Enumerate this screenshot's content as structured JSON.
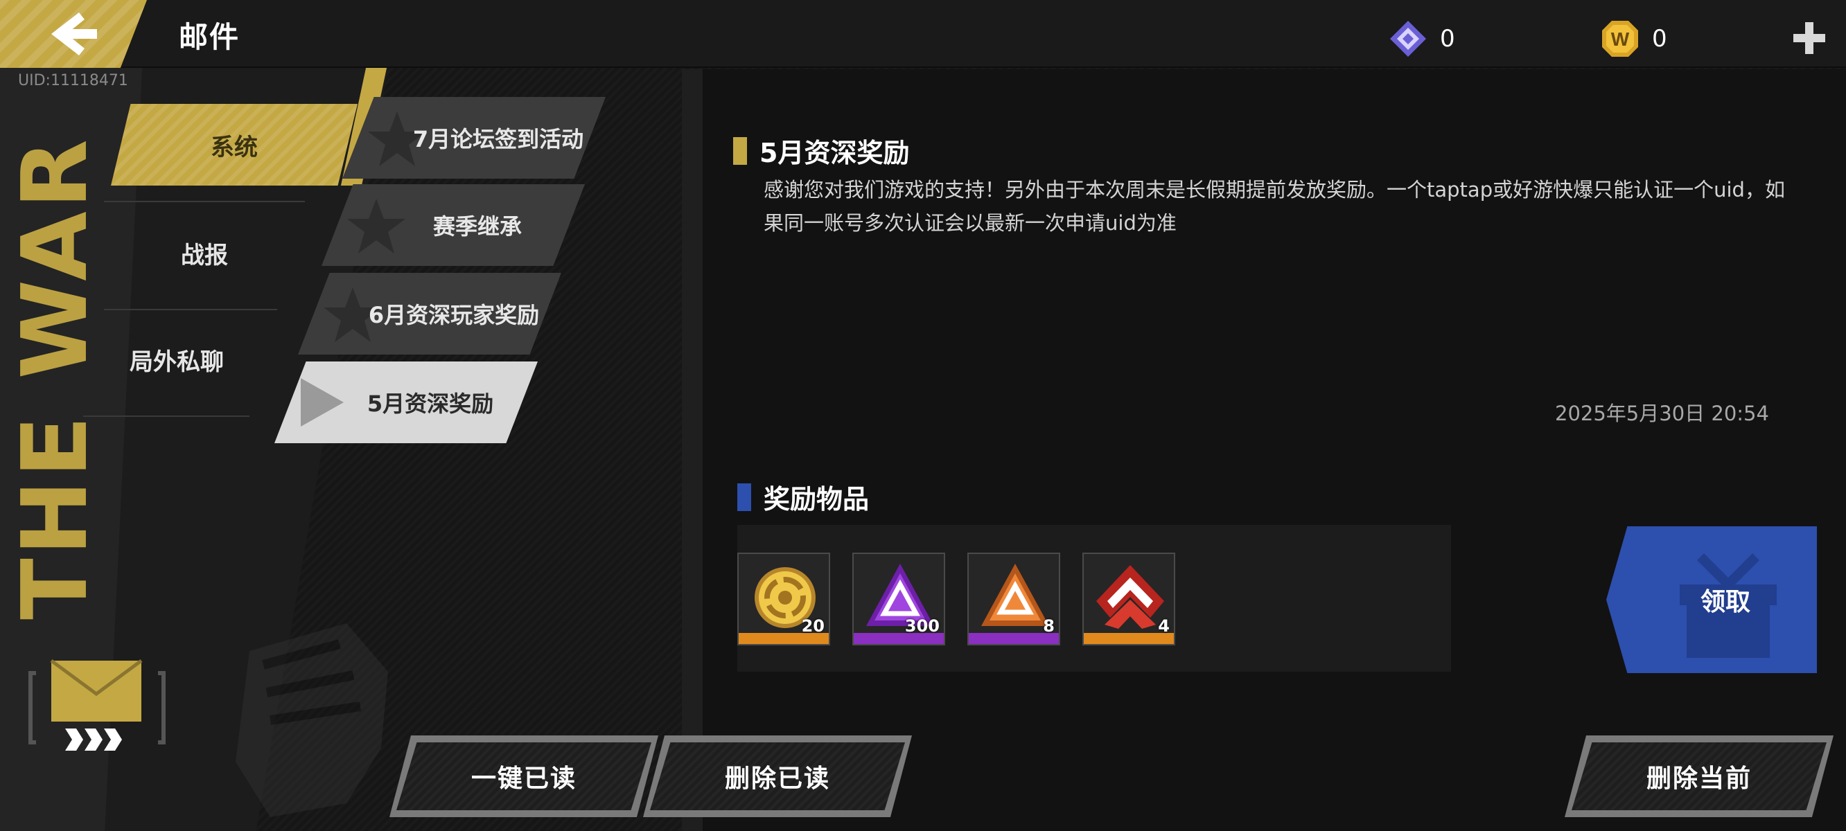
{
  "header": {
    "title": "邮件",
    "uid": "UID:11118471",
    "currencies": [
      {
        "icon": "diamond-gem-icon",
        "value": "0"
      },
      {
        "icon": "gold-w-coin-icon",
        "value": "0"
      }
    ],
    "plus_icon": "plus-icon",
    "back_icon": "back-arrow-icon"
  },
  "decor": {
    "wall_text": "THE WAR"
  },
  "categories": [
    {
      "label": "系统",
      "active": true
    },
    {
      "label": "战报",
      "active": false
    },
    {
      "label": "局外私聊",
      "active": false
    }
  ],
  "mails": [
    {
      "title": "7月论坛签到活动",
      "selected": false
    },
    {
      "title": "赛季继承",
      "selected": false
    },
    {
      "title": "6月资深玩家奖励",
      "selected": false
    },
    {
      "title": "5月资深奖励",
      "selected": true
    }
  ],
  "detail": {
    "title": "5月资深奖励",
    "body": "感谢您对我们游戏的支持！另外由于本次周末是长假期提前发放奖励。一个taptap或好游快爆只能认证一个uid，如果同一账号多次认证会以最新一次申请uid为准",
    "date": "2025年5月30日  20:54",
    "rewards_title": "奖励物品",
    "rewards": [
      {
        "icon": "gold-ring-token-icon",
        "quantity": "20",
        "quality_color": "#e08a1e"
      },
      {
        "icon": "purple-triangle-badge-icon",
        "quantity": "300",
        "quality_color": "#8a2fc0"
      },
      {
        "icon": "orange-triangle-badge-icon",
        "quantity": "8",
        "quality_color": "#8a2fc0"
      },
      {
        "icon": "red-chevron-badge-icon",
        "quantity": "4",
        "quality_color": "#e08a1e"
      }
    ],
    "claim_label": "领取"
  },
  "buttons": {
    "read_all": "一键已读",
    "delete_read": "删除已读",
    "delete_current": "删除当前"
  },
  "colors": {
    "accent_gold": "#c4a844",
    "accent_blue": "#2d4fae"
  }
}
